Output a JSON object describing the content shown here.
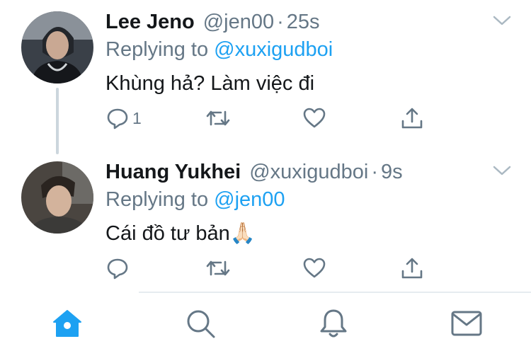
{
  "tweets": [
    {
      "name": "Lee Jeno",
      "handle": "@jen00",
      "time": "25s",
      "replying_prefix": "Replying to",
      "replying_to": "@xuxigudboi",
      "text": "Khùng hả? Làm việc đi",
      "reply_count": "1"
    },
    {
      "name": "Huang Yukhei",
      "handle": "@xuxigudboi",
      "time": "9s",
      "replying_prefix": "Replying to",
      "replying_to": "@jen00",
      "text": "Cái đồ tư bản🙏🏻",
      "reply_count": ""
    }
  ],
  "separator": "·",
  "tabs": [
    "home-icon",
    "search-icon",
    "notifications-icon",
    "messages-icon"
  ],
  "colors": {
    "accent": "#1da1f2",
    "muted": "#657786",
    "text": "#14171a",
    "divider": "#e6ecf0"
  }
}
